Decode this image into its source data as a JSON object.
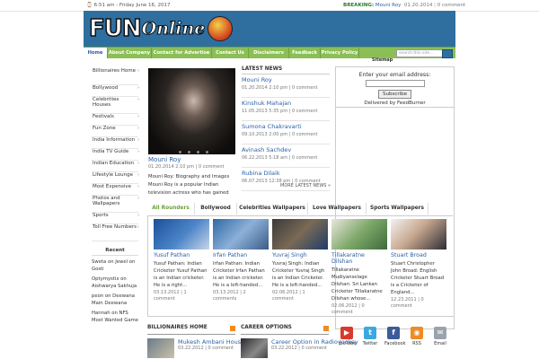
{
  "topbar": {
    "datetime": "6:51 am - Friday June 16, 2017",
    "breaking_label": "BREAKING:",
    "breaking_title": "Mouni Roy",
    "breaking_date": "01.20.2014",
    "breaking_comments": "0 comment"
  },
  "logo": {
    "part1": "FUN",
    "part2": "Online"
  },
  "nav": {
    "items": [
      "Home",
      "About Company",
      "Contact for Advertise",
      "Contact Us",
      "Disclaimers",
      "Feedback",
      "Privacy Policy"
    ],
    "search_placeholder": "search this site...",
    "sitemap": "Sitemap"
  },
  "sidebar": {
    "items": [
      "Billionaires Home",
      "Bollywood",
      "Celebrities Houses",
      "Festivals",
      "Fun Zone",
      "India Information",
      "India TV Guide",
      "Indian Education",
      "Lifestyle Lounge",
      "Most Expensive",
      "Photos and Wallpapers",
      "Sports",
      "Toll Free Numbers"
    ]
  },
  "recent": {
    "title": "Recent",
    "comments": [
      {
        "text": "Sweta on Jewel on Gosti"
      },
      {
        "text": "Optymystix on Aishwarya Sakhuja"
      },
      {
        "text": "peon on Deewana Main Deewana"
      },
      {
        "text": "Hannah on NFS Most Wanted Game"
      }
    ]
  },
  "featured": {
    "title": "Mouni Roy",
    "date": "01.20.2014",
    "time": "2:10 pm",
    "comments": "0 comment",
    "description": "Mouni Roy: Biography and Images Mouni Roy is a popular Indian television actress who has gained"
  },
  "latest_news": {
    "heading": "LATEST NEWS",
    "items": [
      {
        "title": "Mouni Roy",
        "meta": "01.20.2014 2:10 pm  |  0 comment"
      },
      {
        "title": "Kinshuk Mahajan",
        "meta": "11.05.2013 5:35 pm  |  0 comment"
      },
      {
        "title": "Sumona Chakravarti",
        "meta": "09.10.2013 2:00 pm  |  0 comment"
      },
      {
        "title": "Avinash Sachdev",
        "meta": "06.22.2013 5:18 am  |  0 comment"
      },
      {
        "title": "Rubina Dilaik",
        "meta": "06.07.2013 12:38 pm  |  0 comment"
      }
    ],
    "more": "MORE LATEST NEWS »"
  },
  "subscribe": {
    "label": "Enter your email address:",
    "button": "Subscribe",
    "delivered_by": "Delivered by FeedBurner"
  },
  "tabs": {
    "items": [
      "All Rounders",
      "Bollywood",
      "Celebrities Wallpapers",
      "Love Wallpapers",
      "Sports Wallpapers"
    ],
    "active": "All Rounders"
  },
  "cards": [
    {
      "name": "Yusuf Pathan",
      "desc": "Yusuf Pathan: Indian Cricketer Yusuf Pathan is an Indian cricketer. He is a right...",
      "date": "03.13.2012",
      "comments": "1 comment"
    },
    {
      "name": "Irfan Pathan",
      "desc": "Irfan Pathan: Indian Cricketer Irfan Pathan is an Indian cricketer. He is a left-handed...",
      "date": "03.13.2012",
      "comments": "2 comments"
    },
    {
      "name": "Yuvraj Singh",
      "desc": "Yuvraj Singh: Indian Cricketer Yuvraj Singh is an Indian Cricketer. He is a left-handed...",
      "date": "02.06.2012",
      "comments": "1 comment"
    },
    {
      "name": "Tillakaratne Dilshan",
      "desc": "Tillakaratne Mudiyanselage Dilshan: Sri Lankan Cricketer Tillakaratne Dilshan whose...",
      "date": "02.06.2012",
      "comments": "0 comment"
    },
    {
      "name": "Stuart Broad",
      "desc": "Stuart Christopher John Broad: English Cricketer Stuart Broad is a Cricketer of England...",
      "date": "12.23.2011",
      "comments": "0 comment"
    }
  ],
  "bottom": {
    "billionaires_heading": "BILLIONAIRES HOME",
    "billionaires_item": {
      "title": "Mukesh Ambani House",
      "meta": "03.22.2012 | 0 comment"
    },
    "career_heading": "CAREER OPTIONS",
    "career_item": {
      "title": "Career Option in Radio Jockey",
      "meta": "03.22.2012 | 0 comment"
    }
  },
  "social": [
    {
      "label": "YouTube",
      "glyph": "▶",
      "color": "#d93a2b"
    },
    {
      "label": "Twitter",
      "glyph": "t",
      "color": "#3ba9e0"
    },
    {
      "label": "Facebook",
      "glyph": "f",
      "color": "#3b5b99"
    },
    {
      "label": "RSS",
      "glyph": "◉",
      "color": "#f08a24"
    },
    {
      "label": "Email",
      "glyph": "✉",
      "color": "#9aa3ad"
    }
  ]
}
